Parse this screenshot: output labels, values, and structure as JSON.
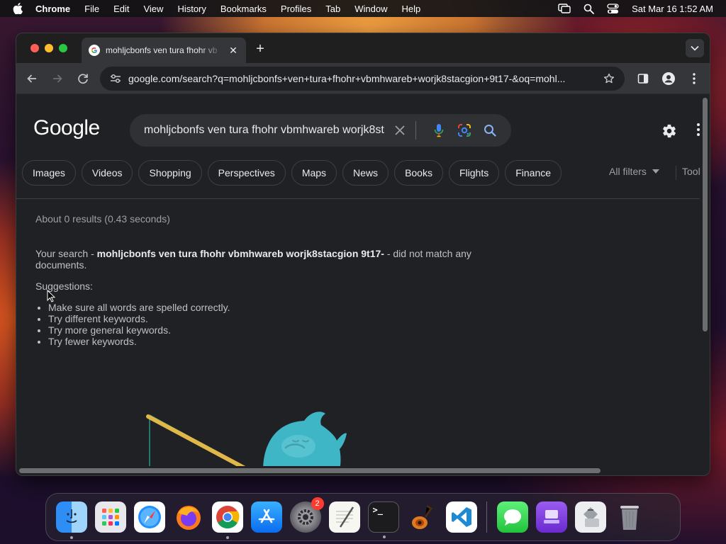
{
  "menubar": {
    "app_name": "Chrome",
    "menus": [
      "File",
      "Edit",
      "View",
      "History",
      "Bookmarks",
      "Profiles",
      "Tab",
      "Window",
      "Help"
    ],
    "clock": "Sat Mar 16  1:52 AM"
  },
  "browser": {
    "tab": {
      "title": "mohljcbonfs ven tura fhohr vb"
    },
    "url": "google.com/search?q=mohljcbonfs+ven+tura+fhohr+vbmhwareb+worjk8stacgion+9t17-&oq=mohl..."
  },
  "google": {
    "logo": "Google",
    "query": "mohljcbonfs ven tura fhohr vbmhwareb worjk8st",
    "chips": [
      "Images",
      "Videos",
      "Shopping",
      "Perspectives",
      "Maps",
      "News",
      "Books",
      "Flights",
      "Finance"
    ],
    "all_filters": "All filters",
    "tools": "Tool",
    "result_stats": "About 0 results (0.43 seconds)",
    "no_results": {
      "prefix": "Your search - ",
      "query": "mohljcbonfs ven tura fhohr vbmhwareb worjk8stacgion 9t17-",
      "suffix": " - did not match any documents."
    },
    "suggestions_heading": "Suggestions:",
    "suggestions": [
      "Make sure all words are spelled correctly.",
      "Try different keywords.",
      "Try more general keywords.",
      "Try fewer keywords."
    ]
  },
  "dock": {
    "apps": [
      {
        "name": "Finder",
        "icon": "finder-icon"
      },
      {
        "name": "Launchpad",
        "icon": "launchpad-icon"
      },
      {
        "name": "Safari",
        "icon": "safari-icon"
      },
      {
        "name": "Firefox",
        "icon": "firefox-icon"
      },
      {
        "name": "Chrome",
        "icon": "chrome-icon"
      },
      {
        "name": "App Store",
        "icon": "app-store-icon"
      },
      {
        "name": "System Settings",
        "icon": "settings-icon",
        "badge": "2"
      },
      {
        "name": "TextEdit",
        "icon": "textedit-icon"
      },
      {
        "name": "Terminal",
        "icon": "terminal-icon"
      },
      {
        "name": "GarageBand",
        "icon": "garageband-icon"
      },
      {
        "name": "VS Code",
        "icon": "vscode-icon"
      },
      {
        "name": "Messages",
        "icon": "messages-icon"
      },
      {
        "name": "Simulator",
        "icon": "simulator-icon"
      },
      {
        "name": "Migration Assistant",
        "icon": "migration-icon"
      },
      {
        "name": "Trash",
        "icon": "trash-icon"
      }
    ],
    "terminal_prompt": ">_"
  }
}
